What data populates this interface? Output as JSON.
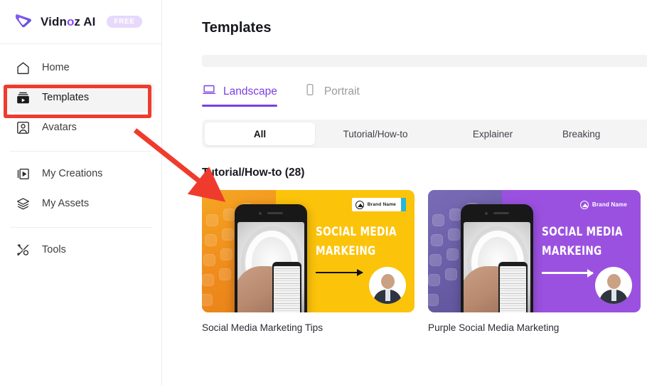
{
  "brand": {
    "name_part1": "Vidn",
    "name_o": "o",
    "name_part2": "z AI",
    "plan_badge": "FREE",
    "logo_icon": "vidnoz-v-logo-icon"
  },
  "sidebar": {
    "primary_items": [
      {
        "label": "Home",
        "icon": "home-icon",
        "active": false
      },
      {
        "label": "Templates",
        "icon": "templates-video-icon",
        "active": true
      },
      {
        "label": "Avatars",
        "icon": "avatar-person-icon",
        "active": false
      }
    ],
    "secondary_items": [
      {
        "label": "My Creations",
        "icon": "my-creations-play-icon",
        "active": false
      },
      {
        "label": "My Assets",
        "icon": "layers-stack-icon",
        "active": false
      }
    ],
    "tertiary_items": [
      {
        "label": "Tools",
        "icon": "tools-wrench-icon",
        "active": false
      }
    ]
  },
  "main": {
    "page_title": "Templates",
    "orientation_tabs": [
      {
        "label": "Landscape",
        "icon": "laptop-icon",
        "active": true
      },
      {
        "label": "Portrait",
        "icon": "phone-icon",
        "active": false
      }
    ],
    "category_filters": [
      {
        "label": "All",
        "active": true
      },
      {
        "label": "Tutorial/How-to",
        "active": false
      },
      {
        "label": "Explainer",
        "active": false
      },
      {
        "label": "Breaking",
        "active": false
      }
    ],
    "section_title": "Tutorial/How-to (28)",
    "cards": [
      {
        "caption": "Social Media Marketing Tips",
        "theme": "yellow",
        "accent": "#fcc30b",
        "headline_line1": "Social Media",
        "headline_line2": "Markeing",
        "brand_label": "Brand Name"
      },
      {
        "caption": "Purple Social Media Marketing",
        "theme": "purple",
        "accent": "#9b51e0",
        "headline_line1": "Social Media",
        "headline_line2": "Markeing",
        "brand_label": "Brand Name"
      }
    ]
  },
  "annotations": {
    "highlight_target": "Templates",
    "highlight_color": "#ef3b2d",
    "arrow_color": "#ef3b2d",
    "arrow_points_to": "Tutorial/How-to (28)"
  },
  "colors": {
    "accent_purple": "#7b3fe4",
    "badge_lavender": "#e6d9fb",
    "card_yellow": "#fcc30b",
    "card_purple": "#9b51e0",
    "annotation_red": "#ef3b2d"
  }
}
